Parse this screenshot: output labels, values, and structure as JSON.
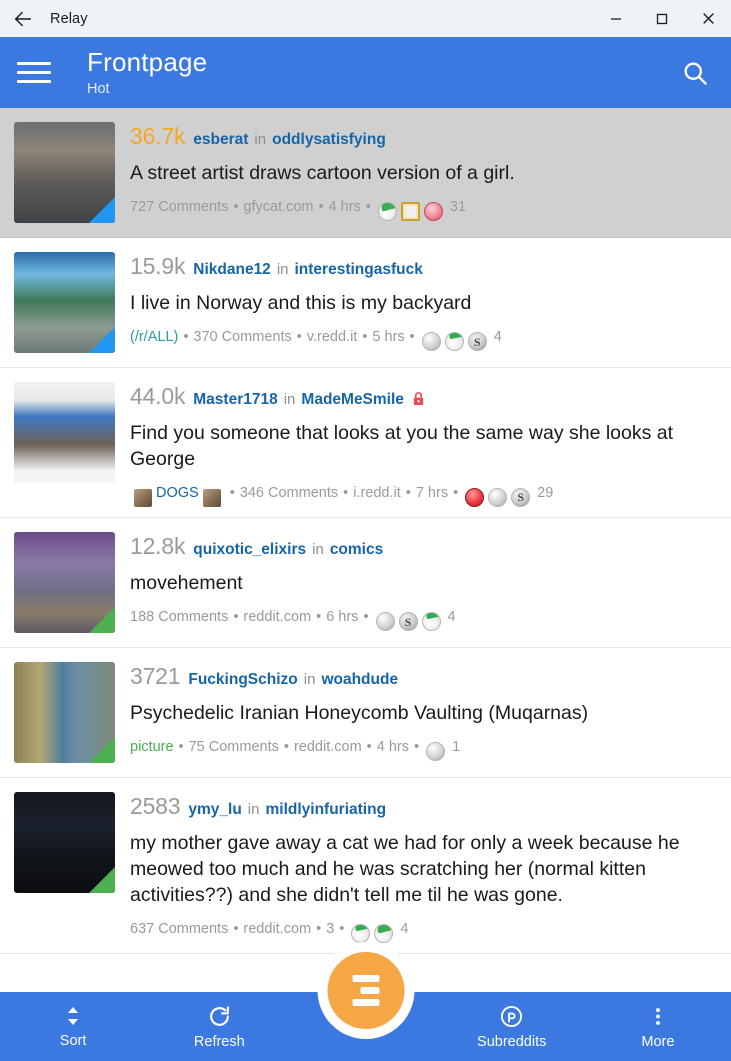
{
  "window": {
    "title": "Relay",
    "back_icon": "back-arrow-icon",
    "minimize_label": "−",
    "maximize_label": "□",
    "close_label": "✕"
  },
  "appbar": {
    "menu_icon": "hamburger-menu-icon",
    "title": "Frontpage",
    "subtitle": "Hot",
    "search_icon": "search-icon",
    "background_color": "#3b78e0"
  },
  "posts": [
    {
      "score": "36.7k",
      "score_highlight": true,
      "author": "esberat",
      "in_word": "in",
      "subreddit": "oddlysatisfying",
      "locked": false,
      "title": "A street artist draws cartoon version of a girl.",
      "meta": {
        "flair": "",
        "flair_style": "",
        "comments": "727 Comments",
        "domain": "gfycat.com",
        "age": "4 hrs",
        "award_count": "31",
        "awards": [
          "a-gnome",
          "a-frame",
          "a-heart"
        ]
      },
      "thumb_corner": "blue",
      "selected": true
    },
    {
      "score": "15.9k",
      "score_highlight": false,
      "author": "Nikdane12",
      "in_word": "in",
      "subreddit": "interestingasfuck",
      "locked": false,
      "title": "I live in Norway and this is my backyard",
      "meta": {
        "flair": "(/r/ALL)",
        "flair_style": "tag-all",
        "comments": "370 Comments",
        "domain": "v.redd.it",
        "age": "5 hrs",
        "award_count": "4",
        "awards": [
          "a-silver",
          "a-snoo",
          "a-dark"
        ]
      },
      "thumb_corner": "blue",
      "selected": false
    },
    {
      "score": "44.0k",
      "score_highlight": false,
      "author": "Master1718",
      "in_word": "in",
      "subreddit": "MadeMeSmile",
      "locked": true,
      "title": "Find you someone that looks at you the same way she looks at George",
      "meta": {
        "flair": "DOGS",
        "flair_style": "flair-label",
        "flair_images": 2,
        "comments": "346 Comments",
        "domain": "i.redd.it",
        "age": "7 hrs",
        "award_count": "29",
        "awards": [
          "a-red",
          "a-silver",
          "a-dark"
        ]
      },
      "thumb_corner": "none",
      "selected": false
    },
    {
      "score": "12.8k",
      "score_highlight": false,
      "author": "quixotic_elixirs",
      "in_word": "in",
      "subreddit": "comics",
      "locked": false,
      "title": "movehement",
      "meta": {
        "flair": "",
        "flair_style": "",
        "comments": "188 Comments",
        "domain": "reddit.com",
        "age": "6 hrs",
        "award_count": "4",
        "awards": [
          "a-silver",
          "a-dark",
          "a-snoo"
        ]
      },
      "thumb_corner": "green",
      "selected": false
    },
    {
      "score": "3721",
      "score_highlight": false,
      "author": "FuckingSchizo",
      "in_word": "in",
      "subreddit": "woahdude",
      "locked": false,
      "title": "Psychedelic Iranian Honeycomb Vaulting (Muqarnas)",
      "meta": {
        "flair": "picture",
        "flair_style": "tag-green",
        "comments": "75 Comments",
        "domain": "reddit.com",
        "age": "4 hrs",
        "award_count": "1",
        "awards": [
          "a-silver"
        ]
      },
      "thumb_corner": "green",
      "selected": false
    },
    {
      "score": "2583",
      "score_highlight": false,
      "author": "ymy_lu",
      "in_word": "in",
      "subreddit": "mildlyinfuriating",
      "locked": false,
      "title": "my mother gave away a cat we had for only a week because he meowed too much and he was scratching her (normal kitten activities??) and she didn't tell me til he was gone.",
      "meta": {
        "flair": "",
        "flair_style": "",
        "comments": "637 Comments",
        "domain": "reddit.com",
        "age": "3",
        "award_count": "4",
        "awards": [
          "a-snoo",
          "a-gnome"
        ]
      },
      "thumb_corner": "green",
      "selected": false
    }
  ],
  "bottomnav": {
    "items": [
      {
        "label": "Sort",
        "icon": "sort-arrows-icon"
      },
      {
        "label": "Refresh",
        "icon": "refresh-icon"
      },
      {
        "label": "Subreddits",
        "icon": "reddit-r-icon"
      },
      {
        "label": "More",
        "icon": "more-vertical-icon"
      }
    ],
    "fab_icon": "compact-view-icon",
    "accent_color": "#f5a645"
  }
}
